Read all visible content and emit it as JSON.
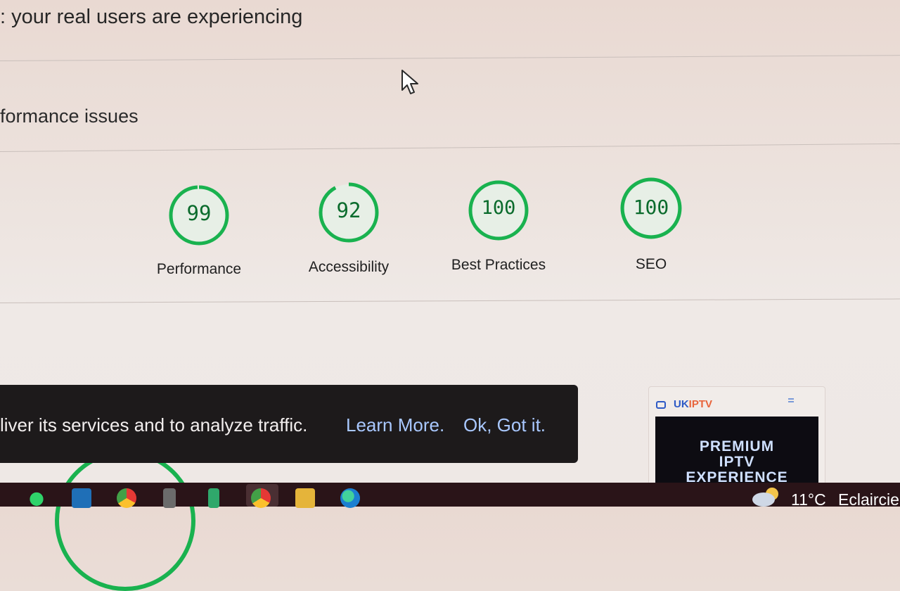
{
  "header": {
    "field_data_heading": ": your real users are experiencing",
    "diagnose_heading": "formance issues"
  },
  "scores": [
    {
      "value": "99",
      "label": "Performance",
      "score": 0.99
    },
    {
      "value": "92",
      "label": "Accessibility",
      "score": 0.92
    },
    {
      "value": "100",
      "label": "Best Practices",
      "score": 1.0
    },
    {
      "value": "100",
      "label": "SEO",
      "score": 1.0
    }
  ],
  "colors": {
    "gauge_pass": "#19b24f",
    "gauge_fill": "#e7efe6",
    "gauge_text": "#0a6b2c",
    "banner_bg": "#1d1a1b",
    "banner_link": "#a9c8ff"
  },
  "cookie_banner": {
    "text": "liver its services and to analyze traffic.",
    "learn_more": "Learn More.",
    "ok": "Ok, Got it."
  },
  "ad": {
    "brand_uk": "UK",
    "brand_iptv": "IPTV",
    "line1": "PREMIUM",
    "line2": "IPTV",
    "line3": "EXPERIENCE"
  },
  "taskbar": {
    "icons": [
      "whatsapp-icon",
      "linkedin-icon",
      "chrome-icon",
      "app-icon",
      "app-icon-2",
      "chrome-icon-2",
      "file-explorer-icon",
      "edge-icon"
    ],
    "temperature": "11°C",
    "condition": "Eclaircie"
  }
}
